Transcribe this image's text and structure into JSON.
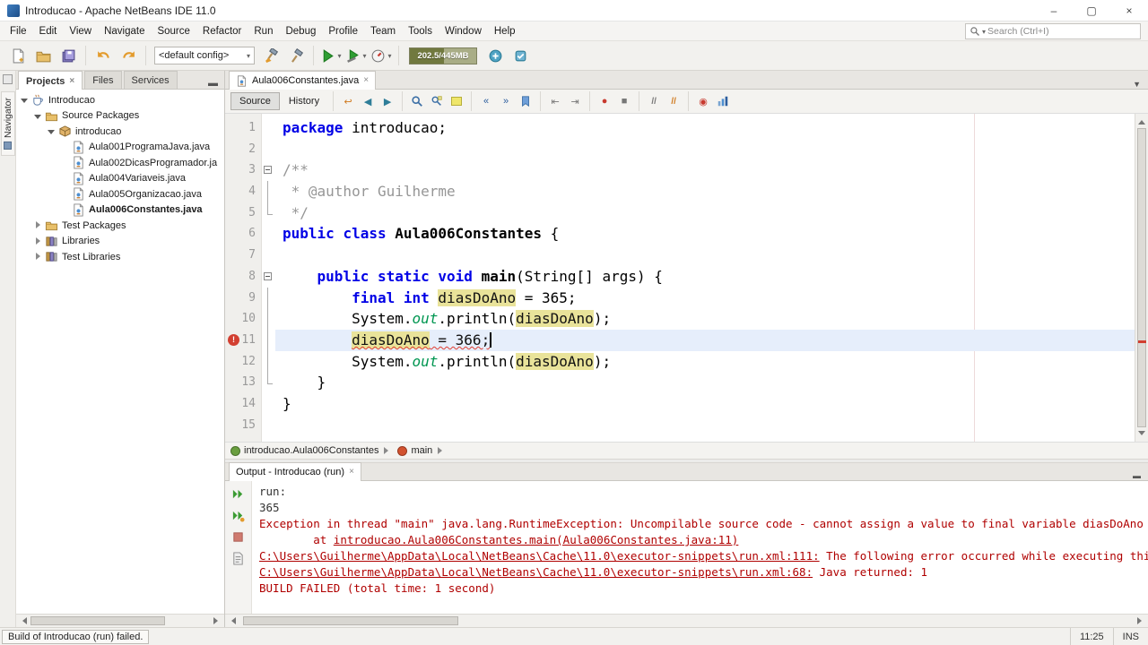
{
  "window": {
    "title": "Introducao - Apache NetBeans IDE 11.0"
  },
  "menubar": {
    "items": [
      "File",
      "Edit",
      "View",
      "Navigate",
      "Source",
      "Refactor",
      "Run",
      "Debug",
      "Profile",
      "Team",
      "Tools",
      "Window",
      "Help"
    ]
  },
  "search": {
    "placeholder": "Search (Ctrl+I)"
  },
  "toolbar": {
    "config": "<default config>",
    "memory": "202.5/445MB"
  },
  "navigator": {
    "label": "Navigator"
  },
  "projects": {
    "tabs": [
      "Projects",
      "Files",
      "Services"
    ],
    "tree": [
      {
        "label": "Introducao",
        "icon": "project",
        "depth": 0,
        "exp": "open"
      },
      {
        "label": "Source Packages",
        "icon": "srcpkg",
        "depth": 1,
        "exp": "open"
      },
      {
        "label": "introducao",
        "icon": "package",
        "depth": 2,
        "exp": "open"
      },
      {
        "label": "Aula001ProgramaJava.java",
        "icon": "java",
        "depth": 3,
        "exp": "leaf"
      },
      {
        "label": "Aula002DicasProgramador.ja",
        "icon": "java",
        "depth": 3,
        "exp": "leaf"
      },
      {
        "label": "Aula004Variaveis.java",
        "icon": "java",
        "depth": 3,
        "exp": "leaf"
      },
      {
        "label": "Aula005Organizacao.java",
        "icon": "java",
        "depth": 3,
        "exp": "leaf"
      },
      {
        "label": "Aula006Constantes.java",
        "icon": "java",
        "depth": 3,
        "exp": "leaf",
        "bold": true
      },
      {
        "label": "Test Packages",
        "icon": "srcpkg",
        "depth": 1,
        "exp": "closed"
      },
      {
        "label": "Libraries",
        "icon": "libs",
        "depth": 1,
        "exp": "closed"
      },
      {
        "label": "Test Libraries",
        "icon": "libs",
        "depth": 1,
        "exp": "closed"
      }
    ]
  },
  "editor": {
    "tab": "Aula006Constantes.java",
    "views": [
      "Source",
      "History"
    ],
    "breadcrumb": [
      "introducao.Aula006Constantes",
      "main"
    ],
    "code": [
      {
        "n": 1,
        "seg": [
          [
            "kw",
            "package"
          ],
          [
            "pl",
            " introducao;"
          ]
        ]
      },
      {
        "n": 2,
        "seg": []
      },
      {
        "n": 3,
        "fold": "box",
        "seg": [
          [
            "cm",
            "/**"
          ]
        ]
      },
      {
        "n": 4,
        "fold": "line",
        "seg": [
          [
            "cm",
            " * @author Guilherme"
          ]
        ]
      },
      {
        "n": 5,
        "fold": "corner",
        "seg": [
          [
            "cm",
            " */"
          ]
        ]
      },
      {
        "n": 6,
        "seg": [
          [
            "kw",
            "public"
          ],
          [
            "pl",
            " "
          ],
          [
            "kw",
            "class"
          ],
          [
            "pl",
            " "
          ],
          [
            "bd",
            "Aula006Constantes"
          ],
          [
            "pl",
            " {"
          ]
        ]
      },
      {
        "n": 7,
        "seg": []
      },
      {
        "n": 8,
        "fold": "box",
        "seg": [
          [
            "pl",
            "    "
          ],
          [
            "kw",
            "public"
          ],
          [
            "pl",
            " "
          ],
          [
            "kw",
            "static"
          ],
          [
            "pl",
            " "
          ],
          [
            "kw",
            "void"
          ],
          [
            "pl",
            " "
          ],
          [
            "bd",
            "main"
          ],
          [
            "pl",
            "(String[] args) {"
          ]
        ]
      },
      {
        "n": 9,
        "fold": "line",
        "seg": [
          [
            "pl",
            "        "
          ],
          [
            "kw",
            "final"
          ],
          [
            "pl",
            " "
          ],
          [
            "kw",
            "int"
          ],
          [
            "pl",
            " "
          ],
          [
            "hl",
            "diasDoAno"
          ],
          [
            "pl",
            " = 365;"
          ]
        ]
      },
      {
        "n": 10,
        "fold": "line",
        "seg": [
          [
            "pl",
            "        System."
          ],
          [
            "fd",
            "out"
          ],
          [
            "pl",
            ".println("
          ],
          [
            "hl",
            "diasDoAno"
          ],
          [
            "pl",
            ");"
          ]
        ]
      },
      {
        "n": 11,
        "fold": "line",
        "cur": true,
        "err": true,
        "seg": [
          [
            "pl",
            "        "
          ],
          [
            "hle",
            "diasDoAno"
          ],
          [
            "ere",
            " = 366;"
          ]
        ]
      },
      {
        "n": 12,
        "fold": "line",
        "seg": [
          [
            "pl",
            "        System."
          ],
          [
            "fd",
            "out"
          ],
          [
            "pl",
            ".println("
          ],
          [
            "hl",
            "diasDoAno"
          ],
          [
            "pl",
            ");"
          ]
        ]
      },
      {
        "n": 13,
        "fold": "corner",
        "seg": [
          [
            "pl",
            "    }"
          ]
        ]
      },
      {
        "n": 14,
        "seg": [
          [
            "pl",
            "}"
          ]
        ]
      },
      {
        "n": 15,
        "seg": []
      }
    ]
  },
  "output": {
    "tab": "Output - Introducao (run)",
    "lines": [
      {
        "seg": [
          [
            "out",
            "run:"
          ]
        ]
      },
      {
        "seg": [
          [
            "out",
            "365"
          ]
        ]
      },
      {
        "seg": [
          [
            "err",
            "Exception in thread \"main\" java.lang.RuntimeException: Uncompilable source code - cannot assign a value to final variable diasDoAno"
          ]
        ]
      },
      {
        "seg": [
          [
            "err",
            "        at "
          ],
          [
            "lnk",
            "introducao.Aula006Constantes.main(Aula006Constantes.java:11)"
          ]
        ]
      },
      {
        "seg": [
          [
            "lnk",
            "C:\\Users\\Guilherme\\AppData\\Local\\NetBeans\\Cache\\11.0\\executor-snippets\\run.xml:111:"
          ],
          [
            "err",
            " The following error occurred while executing this line:"
          ]
        ]
      },
      {
        "seg": [
          [
            "lnk",
            "C:\\Users\\Guilherme\\AppData\\Local\\NetBeans\\Cache\\11.0\\executor-snippets\\run.xml:68:"
          ],
          [
            "err",
            " Java returned: 1"
          ]
        ]
      },
      {
        "seg": [
          [
            "err",
            "BUILD FAILED (total time: 1 second)"
          ]
        ]
      }
    ]
  },
  "statusbar": {
    "message": "Build of Introducao (run) failed.",
    "caret": "11:25",
    "mode": "INS"
  }
}
